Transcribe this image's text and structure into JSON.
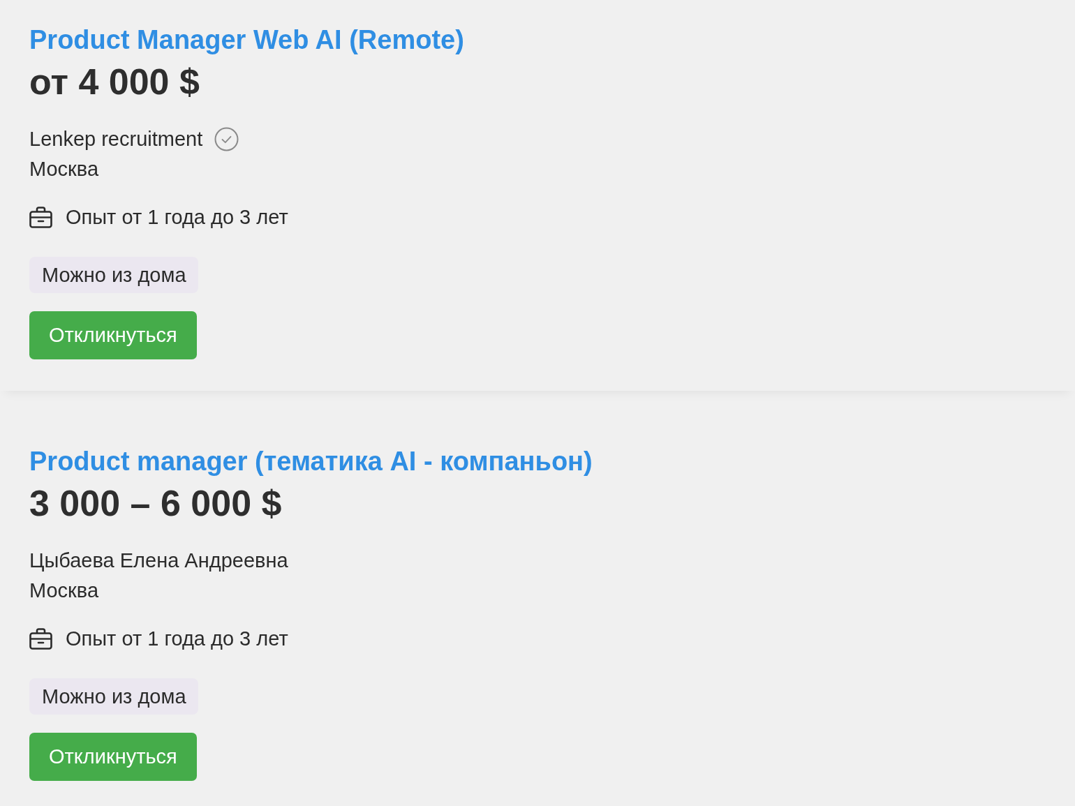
{
  "vacancies": [
    {
      "title": "Product Manager Web AI (Remote)",
      "salary": "от 4 000 $",
      "company": "Lenkep recruitment",
      "verified": true,
      "city": "Москва",
      "experience": "Опыт от 1 года до 3 лет",
      "tags": [
        "Можно из дома"
      ],
      "apply_button": "Откликнуться"
    },
    {
      "title": "Product manager (тематика AI - компаньон)",
      "salary": "3 000 – 6 000 $",
      "company": "Цыбаева Елена Андреевна",
      "verified": false,
      "city": "Москва",
      "experience": "Опыт от 1 года до 3 лет",
      "tags": [
        "Можно из дома"
      ],
      "apply_button": "Откликнуться"
    }
  ]
}
